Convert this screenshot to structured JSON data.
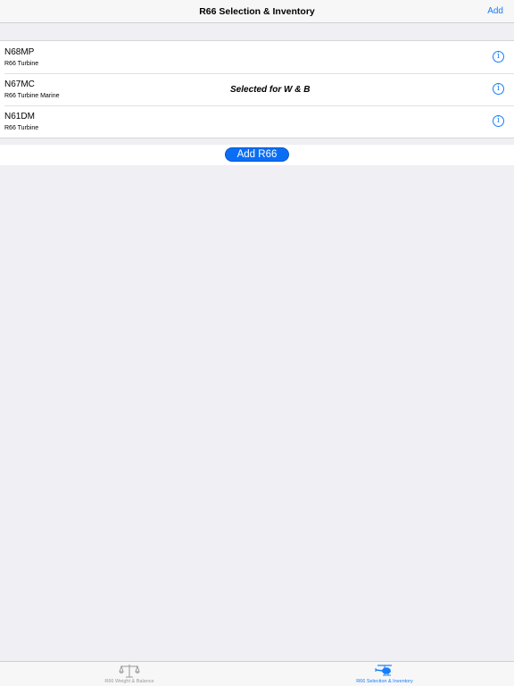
{
  "navbar": {
    "title": "R66 Selection & Inventory",
    "add_label": "Add"
  },
  "aircraft": [
    {
      "tail": "N68MP",
      "model": "R66 Turbine",
      "selected_label": ""
    },
    {
      "tail": "N67MC",
      "model": "R66 Turbine Marine",
      "selected_label": "Selected for W & B"
    },
    {
      "tail": "N61DM",
      "model": "R66 Turbine",
      "selected_label": ""
    }
  ],
  "info_glyph": "i",
  "add_button": {
    "label": "Add R66"
  },
  "tabbar": {
    "tabs": [
      {
        "label": "R66 Weight & Balance",
        "icon": "scale-icon",
        "active": false
      },
      {
        "label": "R66 Selection & Inventory",
        "icon": "helicopter-icon",
        "active": true
      }
    ]
  },
  "colors": {
    "accent": "#157efb",
    "button_fill": "#0a6ef5",
    "background": "#efeff4"
  }
}
